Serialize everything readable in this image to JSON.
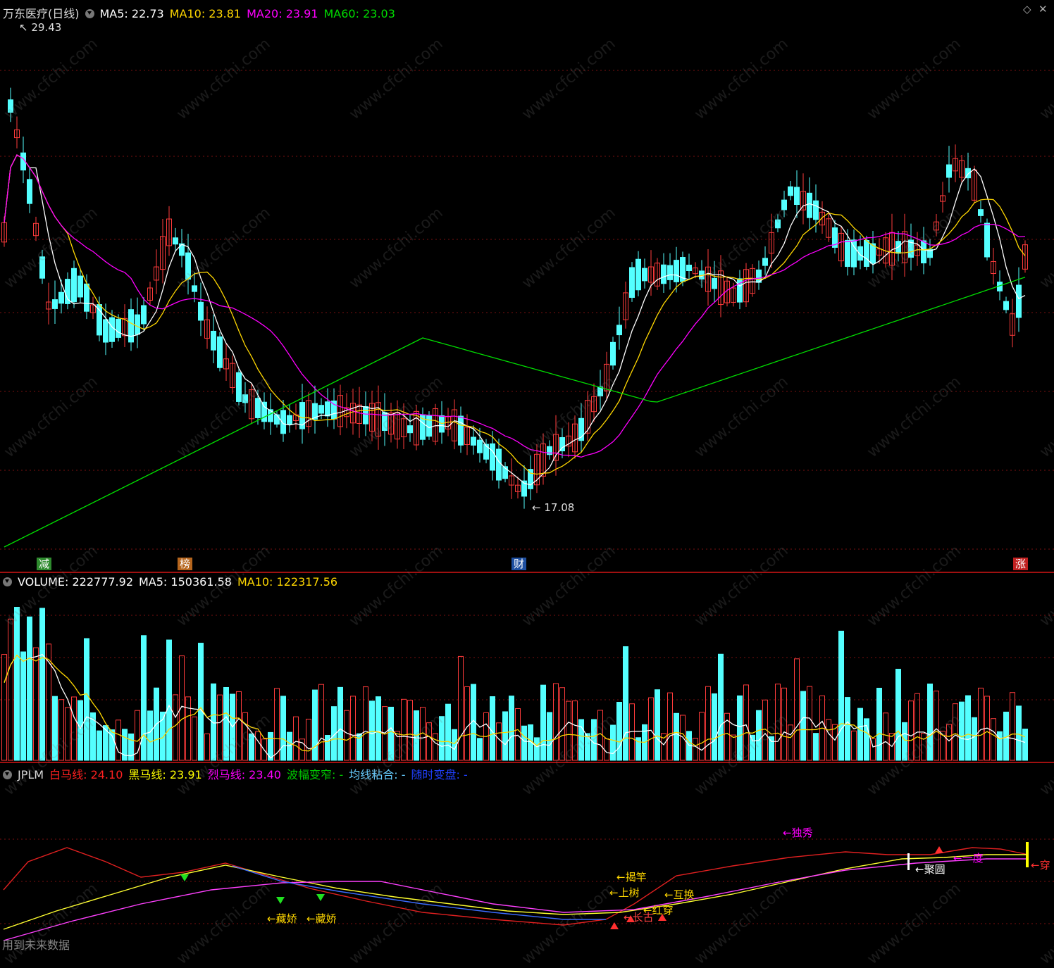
{
  "main_panel": {
    "stock_name": "万东医疗(日线)",
    "ma_labels": [
      {
        "text": "MA5: 22.73",
        "color": "#ffffff"
      },
      {
        "text": "MA10: 23.81",
        "color": "#ffd700"
      },
      {
        "text": "MA20: 23.91",
        "color": "#ff00ff"
      },
      {
        "text": "MA60: 23.03",
        "color": "#00dd00"
      }
    ],
    "high_label": "29.43",
    "low_label": "17.08",
    "event_tags": [
      {
        "text": "减",
        "color": "#2e8b2e"
      },
      {
        "text": "榜",
        "color": "#b5651d"
      },
      {
        "text": "财",
        "color": "#1e4fa0"
      },
      {
        "text": "涨",
        "color": "#c02020"
      }
    ]
  },
  "volume_panel": {
    "labels": [
      {
        "text": "VOLUME: 222777.92",
        "color": "#ffffff"
      },
      {
        "text": "MA5: 150361.58",
        "color": "#ffffff"
      },
      {
        "text": "MA10: 122317.56",
        "color": "#ffd700"
      }
    ]
  },
  "indicator_panel": {
    "name": "JPLM",
    "labels": [
      {
        "text": "白马线: 24.10",
        "color": "#ff2020"
      },
      {
        "text": "黑马线: 23.91",
        "color": "#ffff00"
      },
      {
        "text": "烈马线: 23.40",
        "color": "#ff00ff"
      },
      {
        "text": "波幅变窄: -",
        "color": "#00cc00"
      },
      {
        "text": "均线粘合: -",
        "color": "#66ccff"
      },
      {
        "text": "随时变盘: -",
        "color": "#2040ff"
      }
    ],
    "signals": [
      {
        "text": "←独秀",
        "color": "#ff00ff"
      },
      {
        "text": "←揭竿",
        "color": "#ffd700"
      },
      {
        "text": "←上树",
        "color": "#ffd700"
      },
      {
        "text": "←互换",
        "color": "#ffd700"
      },
      {
        "text": "←藏娇",
        "color": "#ffd700"
      },
      {
        "text": "←藏娇",
        "color": "#ffd700"
      },
      {
        "text": "←红穿",
        "color": "#ffd700"
      },
      {
        "text": "←长古",
        "color": "#ff4040"
      },
      {
        "text": "←一度",
        "color": "#ff00ff"
      },
      {
        "text": "←聚圆",
        "color": "#ffffff"
      },
      {
        "text": "←穿",
        "color": "#ff3030"
      }
    ],
    "footer": "用到未来数据"
  },
  "watermark": "www.cfchi.com",
  "colors": {
    "up": "#ff3b3b",
    "down": "#54ffff",
    "ma5": "#ffffff",
    "ma10": "#ffd700",
    "ma20": "#ff00ff",
    "ma60": "#00dd00",
    "grid": "#7a1010"
  }
}
